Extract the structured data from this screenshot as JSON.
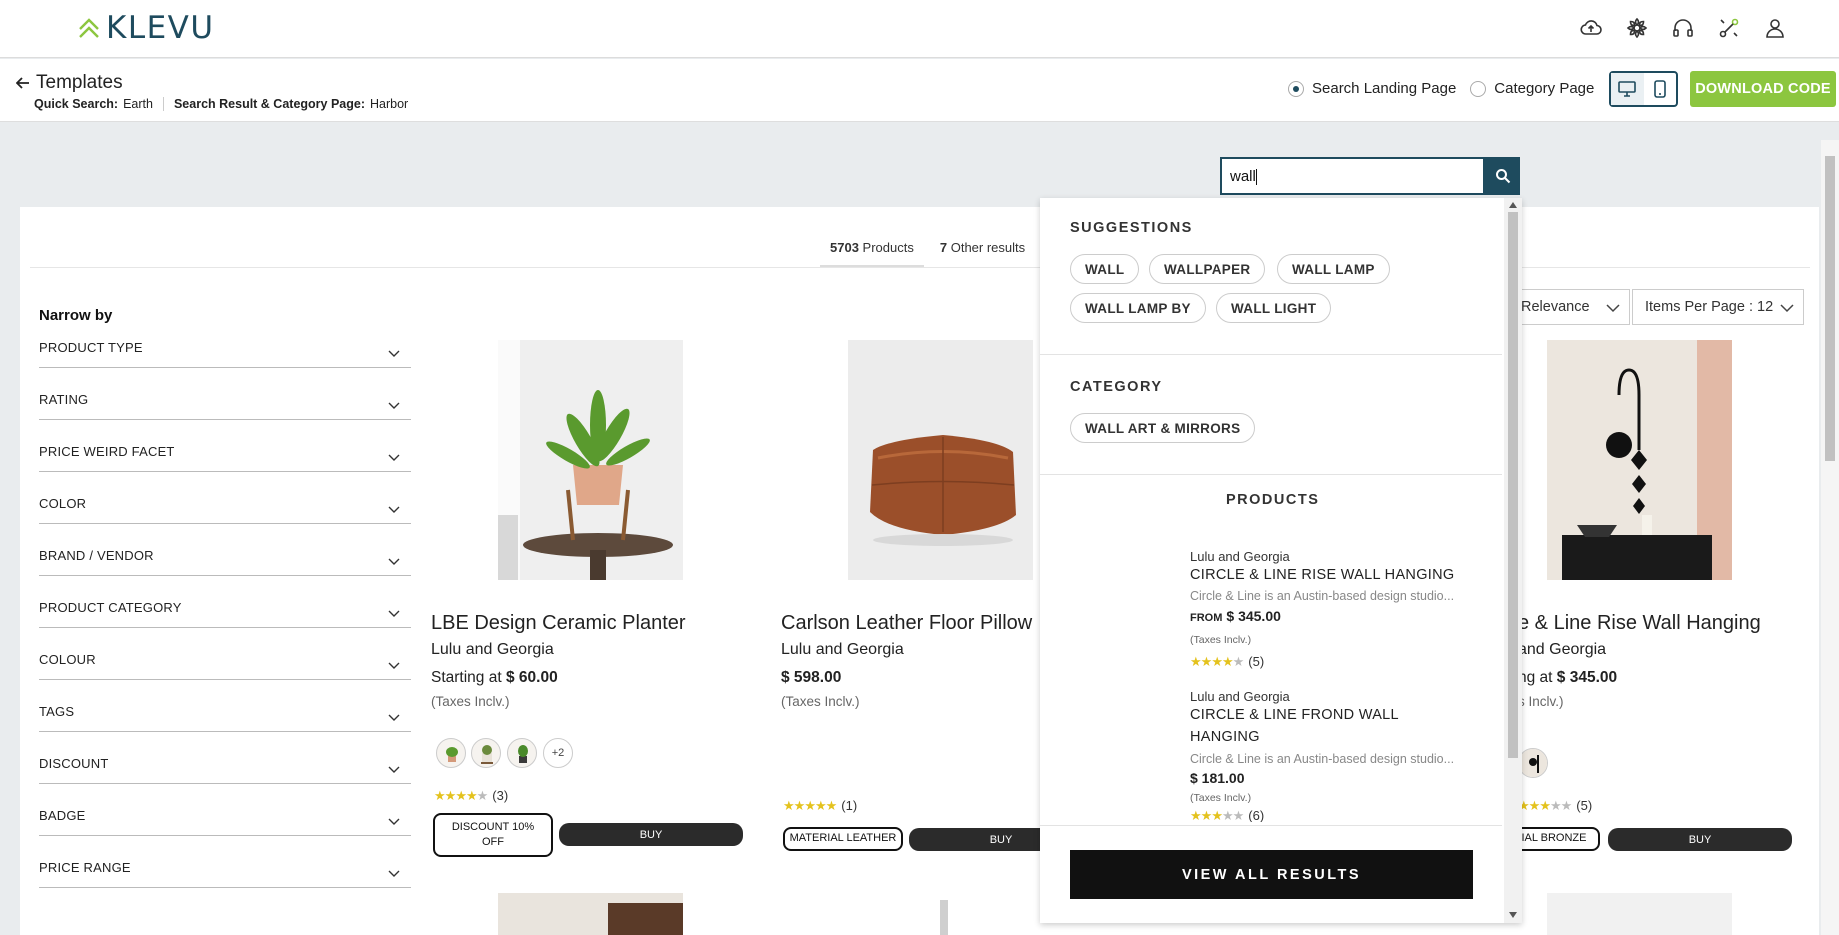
{
  "brand": {
    "name": "KLEVU",
    "accent": "#8cc63f",
    "primary": "#1e4b5e"
  },
  "header": {
    "icons": [
      "cloud-upload-icon",
      "flower-icon",
      "headset-icon",
      "integration-icon",
      "user-icon"
    ]
  },
  "subheader": {
    "back_label": "Templates",
    "quick_search_label": "Quick Search:",
    "quick_search_value": "Earth",
    "srp_label": "Search Result & Category Page:",
    "srp_value": "Harbor",
    "radio_search": "Search Landing Page",
    "radio_category": "Category Page",
    "download_label": "DOWNLOAD CODE"
  },
  "results": {
    "products_count": "5703",
    "products_label": "Products",
    "other_count": "7",
    "other_label": "Other results",
    "sort_label": "Relevance",
    "items_per_page_label": "Items Per Page : 12"
  },
  "sidebar": {
    "title": "Narrow by",
    "facets": [
      "PRODUCT TYPE",
      "RATING",
      "PRICE WEIRD FACET",
      "COLOR",
      "BRAND / VENDOR",
      "PRODUCT CATEGORY",
      "COLOUR",
      "TAGS",
      "DISCOUNT",
      "BADGE",
      "PRICE RANGE"
    ]
  },
  "products": [
    {
      "title": "LBE Design Ceramic Planter",
      "vendor": "Lulu and Georgia",
      "price_prefix": "Starting at",
      "price": "$ 60.00",
      "tax": "(Taxes Inclv.)",
      "more_swatches": "+2",
      "rating": 4,
      "reviews": "(3)",
      "badge": "DISCOUNT 10% OFF",
      "buy": "BUY"
    },
    {
      "title": "Carlson Leather Floor Pillow",
      "vendor": "Lulu and Georgia",
      "price_prefix": "",
      "price": "$ 598.00",
      "tax": "(Taxes Inclv.)",
      "rating": 5,
      "reviews": "(1)",
      "badge": "MATERIAL LEATHER",
      "buy": "BUY"
    },
    {
      "title": "e & Line Rise Wall Hanging",
      "vendor": "and Georgia",
      "price_prefix": "ng at",
      "price": "$ 345.00",
      "tax": "s Inclv.)",
      "rating": 3,
      "reviews": "(5)",
      "badge": "RIAL BRONZE",
      "buy": "BUY"
    }
  ],
  "search": {
    "query": "wall",
    "suggestions_heading": "SUGGESTIONS",
    "suggestions": [
      "WALL",
      "WALLPAPER",
      "WALL LAMP",
      "WALL LAMP BY",
      "WALL LIGHT"
    ],
    "category_heading": "CATEGORY",
    "categories": [
      "WALL ART & MIRRORS"
    ],
    "products_heading": "PRODUCTS",
    "products": [
      {
        "vendor": "Lulu and Georgia",
        "title": "CIRCLE & LINE RISE WALL HANGING",
        "desc": "Circle & Line is an Austin-based design studio...",
        "from": "FROM",
        "price": "$ 345.00",
        "tax": "(Taxes Inclv.)",
        "rating": 4,
        "reviews": "(5)"
      },
      {
        "vendor": "Lulu and Georgia",
        "title": "CIRCLE & LINE FROND WALL HANGING",
        "desc": "Circle & Line is an Austin-based design studio...",
        "from": "",
        "price": "$ 181.00",
        "tax": "(Taxes Inclv.)",
        "rating": 3,
        "reviews": "(6)"
      }
    ],
    "view_all_label": "VIEW ALL RESULTS"
  }
}
